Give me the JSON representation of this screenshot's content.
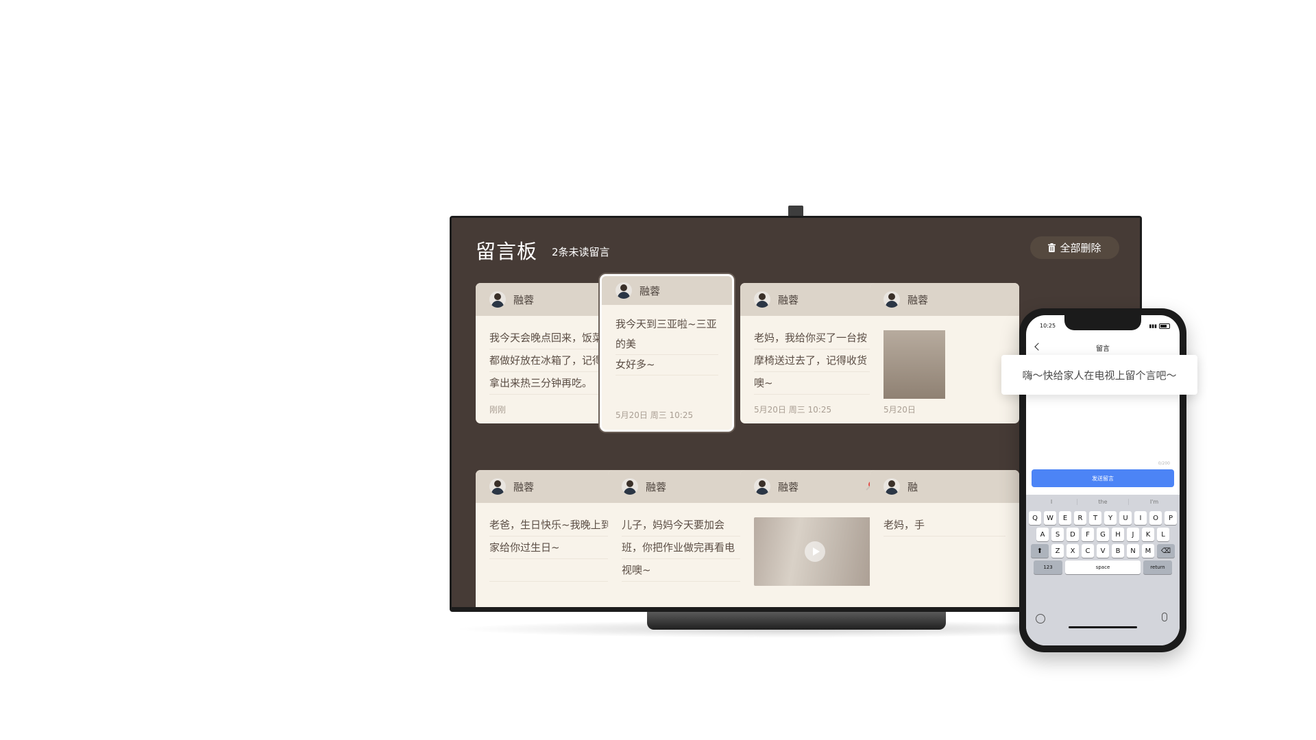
{
  "board": {
    "title": "留言板",
    "unread": "2条未读留言",
    "delete_all": "全部删除",
    "cards": [
      {
        "name": "融蓉",
        "lines": [
          "我今天会晚点回来，饭菜",
          "都做好放在冰箱了，记得",
          "拿出来热三分钟再吃。"
        ],
        "time": "刚刚",
        "pinned": true
      },
      {
        "name": "融蓉",
        "lines": [
          "我今天到三亚啦~三亚的美",
          "女好多~"
        ],
        "time": "5月20日  周三  10:25",
        "selected": true
      },
      {
        "name": "融蓉",
        "lines": [
          "老妈，我给你买了一台按",
          "摩椅送过去了，记得收货",
          "噢~"
        ],
        "time": "5月20日  周三  10:25"
      },
      {
        "name": "融蓉",
        "lines": [],
        "time": "5月20日"
      },
      {
        "name": "融蓉",
        "lines": [
          "老爸，生日快乐~我晚上到",
          "家给你过生日~"
        ]
      },
      {
        "name": "融蓉",
        "lines": [
          "儿子，妈妈今天要加会",
          "班，你把作业做完再看电",
          "视噢~"
        ]
      },
      {
        "name": "融蓉",
        "lines": [],
        "video": true,
        "pinned": true
      },
      {
        "name": "融",
        "lines": [
          "老妈，手"
        ]
      }
    ]
  },
  "phone": {
    "status_time": "10:25",
    "nav_title": "留言",
    "counter": "0/200",
    "send_button": "发送留言",
    "suggestions": [
      "I",
      "the",
      "I'm"
    ],
    "keys_row1": [
      "Q",
      "W",
      "E",
      "R",
      "T",
      "Y",
      "U",
      "I",
      "O",
      "P"
    ],
    "keys_row2": [
      "A",
      "S",
      "D",
      "F",
      "G",
      "H",
      "J",
      "K",
      "L"
    ],
    "keys_row3": [
      "Z",
      "X",
      "C",
      "V",
      "B",
      "N",
      "M"
    ],
    "key_123": "123",
    "key_space": "space",
    "key_return": "return"
  },
  "bubble": {
    "text": "嗨～快给家人在电视上留个言吧～"
  },
  "colors": {
    "board_bg": "#463b36",
    "card_bg": "#f8f3ea",
    "card_head": "#dcd4c9",
    "send_btn": "#4c84f6",
    "pin": "#e24b46"
  }
}
